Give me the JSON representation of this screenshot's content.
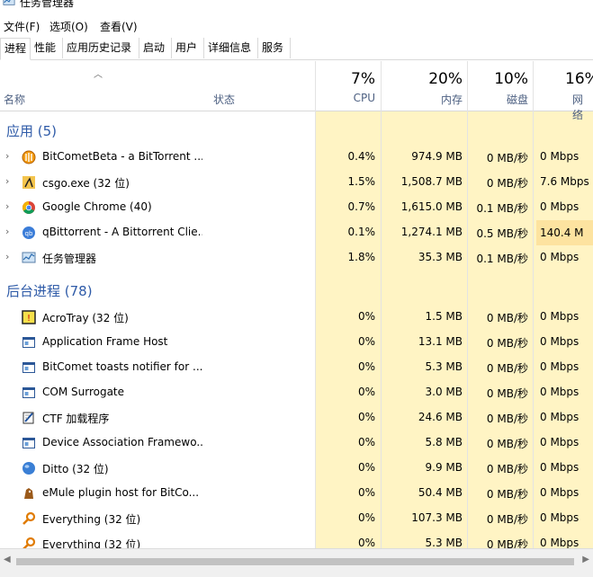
{
  "window": {
    "title": "任务管理器"
  },
  "menu": [
    "文件(F)",
    "选项(O)",
    "查看(V)"
  ],
  "tabs": [
    "进程",
    "性能",
    "应用历史记录",
    "启动",
    "用户",
    "详细信息",
    "服务"
  ],
  "columns": {
    "name": "名称",
    "status": "状态",
    "cpu": {
      "pct": "7%",
      "label": "CPU"
    },
    "mem": {
      "pct": "20%",
      "label": "内存"
    },
    "disk": {
      "pct": "10%",
      "label": "磁盘"
    },
    "net": {
      "pct": "16%",
      "label": "网络"
    }
  },
  "groups": {
    "apps": "应用 (5)",
    "background": "后台进程 (78)"
  },
  "apps": [
    {
      "name": "BitCometBeta - a BitTorrent ...",
      "icon": "bitcomet-icon",
      "cpu": "0.4%",
      "mem": "974.9 MB",
      "disk": "0 MB/秒",
      "net": "0 Mbps"
    },
    {
      "name": "csgo.exe (32 位)",
      "icon": "csgo-icon",
      "cpu": "1.5%",
      "mem": "1,508.7 MB",
      "disk": "0 MB/秒",
      "net": "7.6 Mbps"
    },
    {
      "name": "Google Chrome (40)",
      "icon": "chrome-icon",
      "cpu": "0.7%",
      "mem": "1,615.0 MB",
      "disk": "0.1 MB/秒",
      "net": "0 Mbps"
    },
    {
      "name": "qBittorrent - A Bittorrent Clie...",
      "icon": "qbittorrent-icon",
      "cpu": "0.1%",
      "mem": "1,274.1 MB",
      "disk": "0.5 MB/秒",
      "net": "140.4 M"
    },
    {
      "name": "任务管理器",
      "icon": "task-manager-icon",
      "cpu": "1.8%",
      "mem": "35.3 MB",
      "disk": "0.1 MB/秒",
      "net": "0 Mbps"
    }
  ],
  "background": [
    {
      "name": "AcroTray (32 位)",
      "icon": "acrotray-icon",
      "cpu": "0%",
      "mem": "1.5 MB",
      "disk": "0 MB/秒",
      "net": "0 Mbps"
    },
    {
      "name": "Application Frame Host",
      "icon": "app-window-icon",
      "cpu": "0%",
      "mem": "13.1 MB",
      "disk": "0 MB/秒",
      "net": "0 Mbps"
    },
    {
      "name": "BitComet toasts notifier for ...",
      "icon": "app-window-icon",
      "cpu": "0%",
      "mem": "5.3 MB",
      "disk": "0 MB/秒",
      "net": "0 Mbps"
    },
    {
      "name": "COM Surrogate",
      "icon": "app-window-icon",
      "cpu": "0%",
      "mem": "3.0 MB",
      "disk": "0 MB/秒",
      "net": "0 Mbps"
    },
    {
      "name": "CTF 加载程序",
      "icon": "ctf-loader-icon",
      "cpu": "0%",
      "mem": "24.6 MB",
      "disk": "0 MB/秒",
      "net": "0 Mbps"
    },
    {
      "name": "Device Association Framewo...",
      "icon": "app-window-icon",
      "cpu": "0%",
      "mem": "5.8 MB",
      "disk": "0 MB/秒",
      "net": "0 Mbps"
    },
    {
      "name": "Ditto (32 位)",
      "icon": "ditto-icon",
      "cpu": "0%",
      "mem": "9.9 MB",
      "disk": "0 MB/秒",
      "net": "0 Mbps"
    },
    {
      "name": "eMule plugin host for BitCo...",
      "icon": "emule-icon",
      "cpu": "0%",
      "mem": "50.4 MB",
      "disk": "0 MB/秒",
      "net": "0 Mbps"
    },
    {
      "name": "Everything (32 位)",
      "icon": "everything-search-icon",
      "cpu": "0%",
      "mem": "107.3 MB",
      "disk": "0 MB/秒",
      "net": "0 Mbps"
    },
    {
      "name": "Everything (32 位)",
      "icon": "everything-search-icon",
      "cpu": "0%",
      "mem": "5.3 MB",
      "disk": "0 MB/秒",
      "net": "0 Mbps"
    }
  ]
}
